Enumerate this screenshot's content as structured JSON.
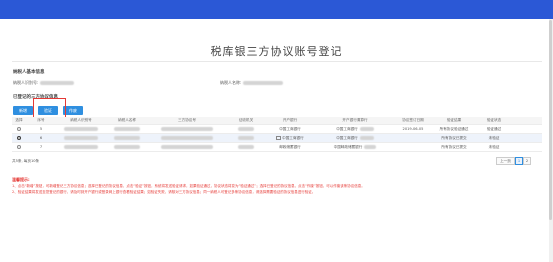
{
  "page_title": "税库银三方协议账号登记",
  "colors": {
    "topbar": "#2b58d6",
    "button": "#2f8fe0",
    "highlight": "#e53935",
    "tips": "#e53935"
  },
  "basic_info": {
    "heading": "纳税人基本信息",
    "tax_id_label": "纳税人识别号:",
    "name_label": "纳税人名称:"
  },
  "agreement": {
    "heading": "已登记的三方协议信息",
    "buttons": {
      "add": "新增",
      "verify": "验证",
      "delete": "作废"
    },
    "columns": [
      "选择",
      "序号",
      "纳税人识别号",
      "纳税人名称",
      "三方协议号",
      "征收机关",
      "开户银行",
      "开户银行清算行",
      "协议签订日期",
      "验证结果",
      "验证状态"
    ],
    "rows": [
      {
        "selected": false,
        "seq": "5",
        "bank": "中国工商银行",
        "clearing_bank": "中国工商银行",
        "date": "2019-06-05",
        "result": "所有协议验证通过",
        "status": "验证通过"
      },
      {
        "selected": true,
        "seq": "6",
        "bank": "中国工商银行",
        "clearing_bank": "中国工商银行",
        "date": "",
        "result": "所有协议已提交",
        "status": "未验证"
      },
      {
        "selected": false,
        "seq": "7",
        "bank": "邮政储蓄银行",
        "clearing_bank": "中国邮政储蓄银行",
        "date": "",
        "result": "所有协议已提交",
        "status": "未验证"
      }
    ]
  },
  "pager": {
    "count_text": "共5条, 每页10条",
    "prev": "上一页",
    "current": "1",
    "next": "2"
  },
  "tips": {
    "title": "温馨提示:",
    "line1": "1、点击“新增”按钮，可新增登记三方协议信息；选择已登记的协议信息，点击“验证”按钮，系统将发送验证请求，如果验证通过，协议状态将变为“验证通过”；选择已登记的协议信息，点击“作废”按钮，可以作废该条协议信息。",
    "line2": "2、验证结果将发送至您登记的银行，请及时到开户银行或登录网上银行查看验证结果；如验证失败，请核对三方协议信息；同一纳税人可登记多条协议信息，请选择需要验证的协议信息进行验证。"
  }
}
